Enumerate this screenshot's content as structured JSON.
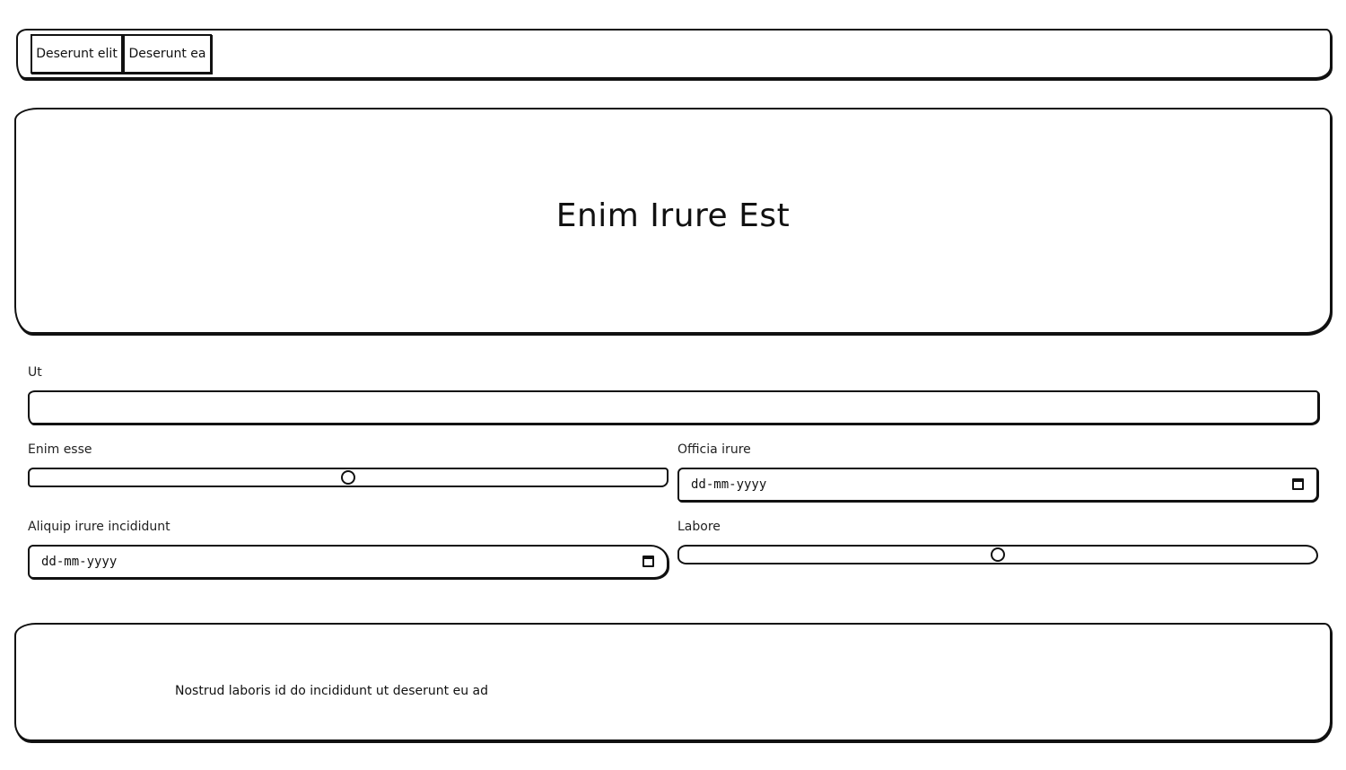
{
  "nav": {
    "buttons": [
      {
        "label": "Deserunt elit"
      },
      {
        "label": "Deserunt ea"
      }
    ]
  },
  "hero": {
    "title": "Enim Irure Est"
  },
  "form": {
    "ut": {
      "label": "Ut",
      "value": ""
    },
    "enim_esse": {
      "label": "Enim esse",
      "value_fraction": 0.5
    },
    "officia_irure": {
      "label": "Officia irure",
      "placeholder": "dd-mm-yyyy"
    },
    "aliquip": {
      "label": "Aliquip irure incididunt",
      "placeholder": "dd-mm-yyyy"
    },
    "labore": {
      "label": "Labore",
      "value_fraction": 0.5
    }
  },
  "footer": {
    "text": "Nostrud laboris id do incididunt ut deserunt eu ad"
  },
  "icons": {
    "calendar": "calendar-icon"
  }
}
